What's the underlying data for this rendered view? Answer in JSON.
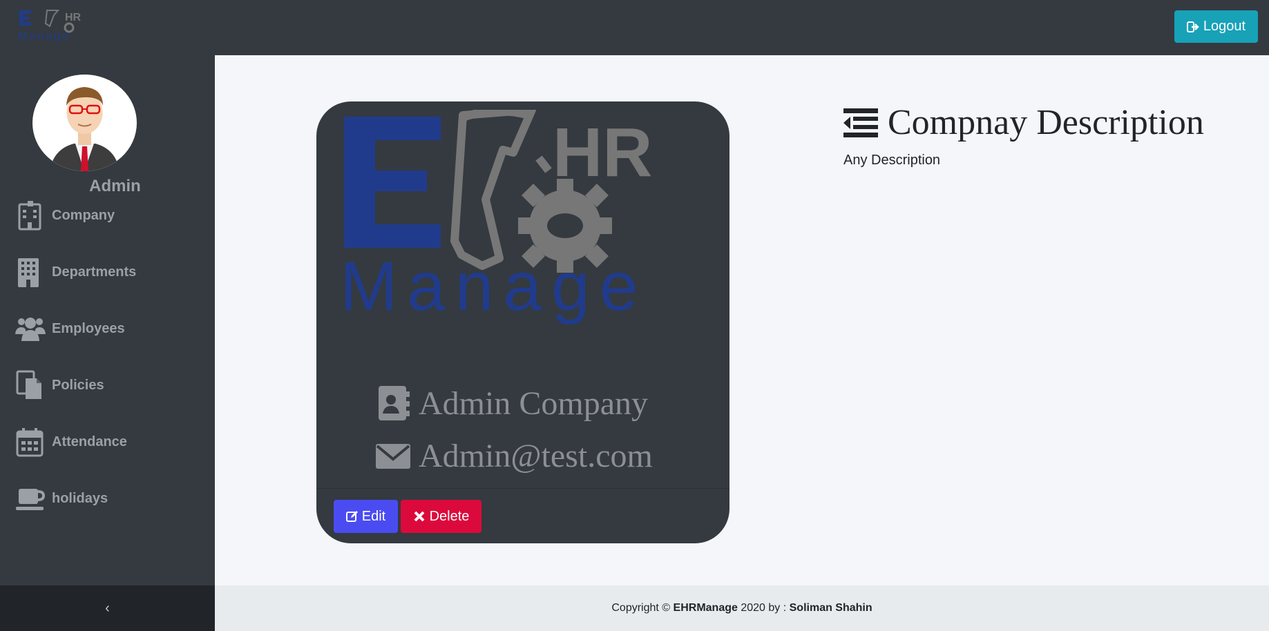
{
  "header": {
    "logo_icon": "ehrmanage-logo",
    "logout_label": "Logout",
    "logout_icon": "sign-out-icon",
    "logout_color": "#17a2b8"
  },
  "sidebar": {
    "user_name": "Admin",
    "items": [
      {
        "label": "Company",
        "icon": "building-icon"
      },
      {
        "label": "Departments",
        "icon": "office-building-icon"
      },
      {
        "label": "Employees",
        "icon": "users-icon"
      },
      {
        "label": "Policies",
        "icon": "files-icon"
      },
      {
        "label": "Attendance",
        "icon": "calendar-icon"
      },
      {
        "label": "holidays",
        "icon": "coffee-icon"
      }
    ],
    "collapse_label": "‹"
  },
  "card": {
    "company_name": "Admin Company",
    "email": "Admin@test.com",
    "edit_label": "Edit",
    "delete_label": "Delete",
    "edit_color": "#4a4cf2",
    "delete_color": "#dc0a3c"
  },
  "description": {
    "title": "Compnay Description",
    "text": "Any Description"
  },
  "footer": {
    "prefix": "Copyright ©",
    "brand": "EHRManage",
    "middle": "2020 by :",
    "author": "Soliman Shahin"
  }
}
